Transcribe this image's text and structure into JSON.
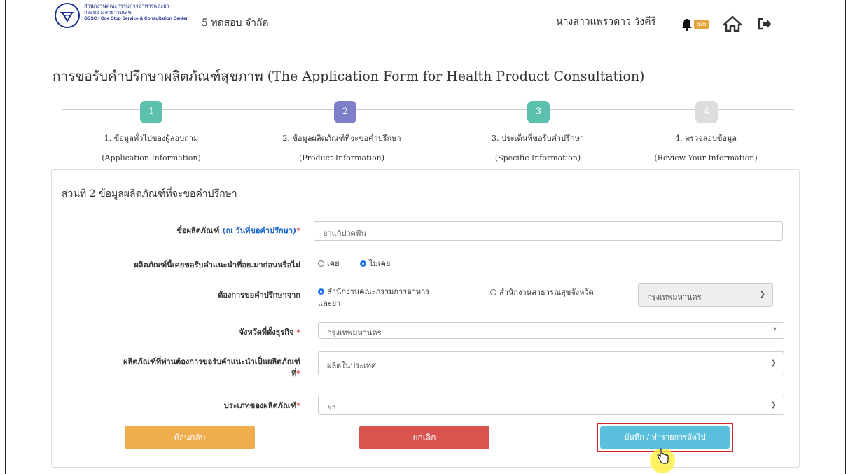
{
  "header": {
    "org_line1": "สำนักงานคณะกรรมการอาหารและยา",
    "org_line2": "กระทรวงสาธารณสุข",
    "org_line3": "OSSC | One Stop Service & Consultation Center",
    "company": "5 ทดสอบ จำกัด",
    "user": "นางสาวแพรวดาว วังคีรี",
    "notification_count": "616"
  },
  "page_title": "การขอรับคำปรึกษาผลิตภัณฑ์สุขภาพ (The Application Form for Health Product Consultation)",
  "steps": [
    {
      "num": "1",
      "label": "1. ข้อมูลทั่วไปของผู้สอบถาม",
      "sub": "(Application Information)",
      "color": "#5bc0ae"
    },
    {
      "num": "2",
      "label": "2. ข้อมูลผลิตภัณฑ์ที่จะขอคำปรึกษา",
      "sub": "(Product Information)",
      "color": "#7d7fc9"
    },
    {
      "num": "3",
      "label": "3. ประเด็นที่ขอรับคำปรึกษา",
      "sub": "(Specific Information)",
      "color": "#5bc0ae"
    },
    {
      "num": "4",
      "label": "4. ตรวจสอบข้อมูล",
      "sub": "(Review Your Information)",
      "color": "#dddddd"
    }
  ],
  "form": {
    "section_title": "ส่วนที่ 2 ข้อมูลผลิตภัณฑ์ที่จะขอคำปรึกษา",
    "product_name_label": "ชื่อผลิตภัณฑ์ ",
    "product_name_hint": "(ณ วันที่ขอคำปรึกษา)",
    "req_mark": "*",
    "product_name_value": "ยาแก้ปวดฟัน",
    "prior_advice_label": "ผลิตภัณฑ์นี้เคยขอรับคำแนะนำที่อย.มาก่อนหรือไม่",
    "prior_advice_options": [
      "เคย",
      "ไม่เคย"
    ],
    "prior_advice_selected": "ไม่เคย",
    "consult_from_label": "ต้องการขอคำปรึกษาจาก",
    "consult_option_1_line1": "สำนักงานคณะกรรมการอาหาร",
    "consult_option_1_line2": "และยา",
    "consult_option_2": "สำนักงานสาธารณสุขจังหวัด",
    "consult_province_select": "กรุงเทพมหานคร",
    "business_province_label": "จังหวัดที่ตั้งธุรกิจ ",
    "business_province_value": "กรุงเทพมหานคร",
    "product_origin_label_line1": "ผลิตภัณฑ์ที่ท่านต้องการขอรับคำแนะนำเป็นผลิตภัณฑ์",
    "product_origin_label_line2": "ที่",
    "product_origin_value": "ผลิตในประเทศ",
    "product_type_label": "ประเภทของผลิตภัณฑ์",
    "product_type_value": "ยา"
  },
  "buttons": {
    "back": "ย้อนกลับ",
    "cancel": "ยกเลิก",
    "save_next": "บันทึก / ทำรายการถัดไป"
  }
}
